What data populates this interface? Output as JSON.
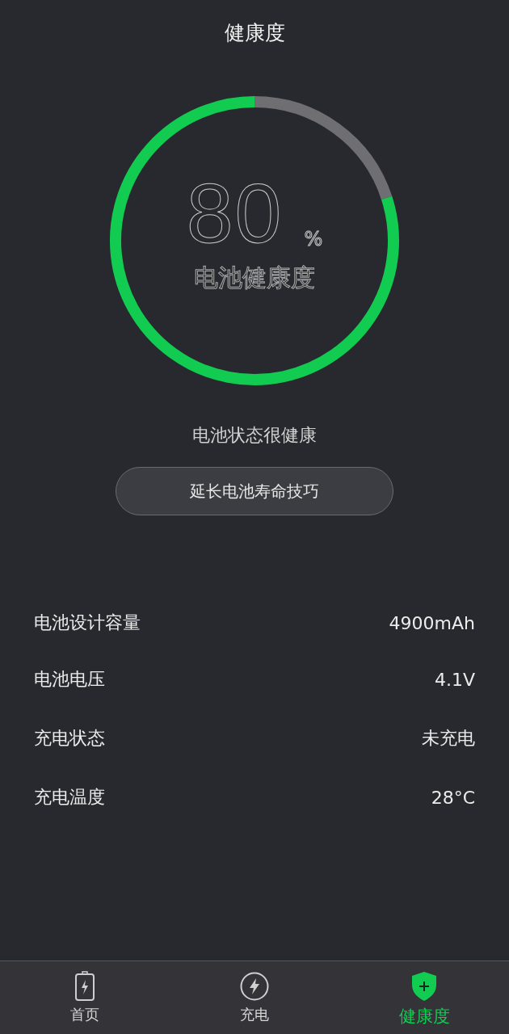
{
  "title": "健康度",
  "gauge": {
    "value": "80",
    "unit": "%",
    "label": "电池健康度"
  },
  "status": "电池状态很健康",
  "tips_button": "延长电池寿命技巧",
  "details": [
    {
      "label": "电池设计容量",
      "value": "4900mAh"
    },
    {
      "label": "电池电压",
      "value": "4.1V"
    },
    {
      "label": "充电状态",
      "value": "未充电"
    },
    {
      "label": "充电温度",
      "value": "28°C"
    }
  ],
  "nav": [
    {
      "kind": "battery",
      "label": "首页",
      "selected": false
    },
    {
      "kind": "charge",
      "label": "充电",
      "selected": false
    },
    {
      "kind": "shield",
      "label": "健康度",
      "selected": true
    }
  ]
}
